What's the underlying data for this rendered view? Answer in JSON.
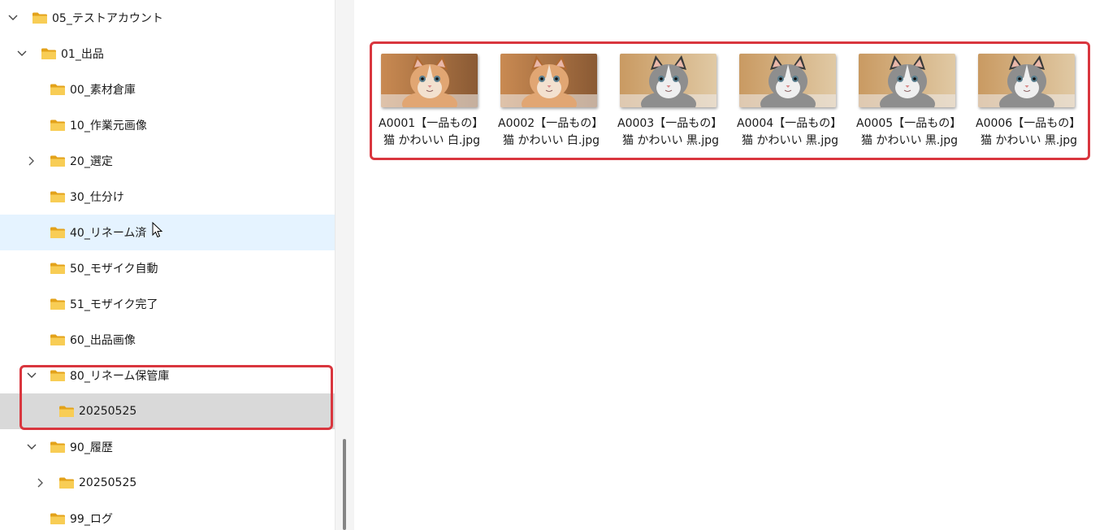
{
  "tree": {
    "items": [
      {
        "label": "05_テストアカウント",
        "chevron": "down"
      },
      {
        "label": "01_出品",
        "chevron": "down"
      },
      {
        "label": "00_素材倉庫",
        "chevron": ""
      },
      {
        "label": "10_作業元画像",
        "chevron": ""
      },
      {
        "label": "20_選定",
        "chevron": "right"
      },
      {
        "label": "30_仕分け",
        "chevron": ""
      },
      {
        "label": "40_リネーム済",
        "chevron": "",
        "state": "hover"
      },
      {
        "label": "50_モザイク自動",
        "chevron": ""
      },
      {
        "label": "51_モザイク完了",
        "chevron": ""
      },
      {
        "label": "60_出品画像",
        "chevron": ""
      },
      {
        "label": "80_リネーム保管庫",
        "chevron": "down"
      },
      {
        "label": "20250525",
        "chevron": "",
        "state": "selected"
      },
      {
        "label": "90_履歴",
        "chevron": "down"
      },
      {
        "label": "20250525",
        "chevron": "right"
      },
      {
        "label": "99_ログ",
        "chevron": ""
      }
    ]
  },
  "files": [
    {
      "line1": "A0001【一品もの】",
      "line2": "猫 かわいい 白.jpg",
      "cat": "orange"
    },
    {
      "line1": "A0002【一品もの】",
      "line2": "猫 かわいい 白.jpg",
      "cat": "orange"
    },
    {
      "line1": "A0003【一品もの】",
      "line2": "猫 かわいい 黒.jpg",
      "cat": "tabby"
    },
    {
      "line1": "A0004【一品もの】",
      "line2": "猫 かわいい 黒.jpg",
      "cat": "tabby"
    },
    {
      "line1": "A0005【一品もの】",
      "line2": "猫 かわいい 黒.jpg",
      "cat": "tabby"
    },
    {
      "line1": "A0006【一品もの】",
      "line2": "猫 かわいい 黒.jpg",
      "cat": "tabby"
    }
  ],
  "colors": {
    "highlight": "#d9363e",
    "folder": "#f5c242",
    "hover_row": "#e5f3ff",
    "selected_row": "#d9d9d9"
  }
}
